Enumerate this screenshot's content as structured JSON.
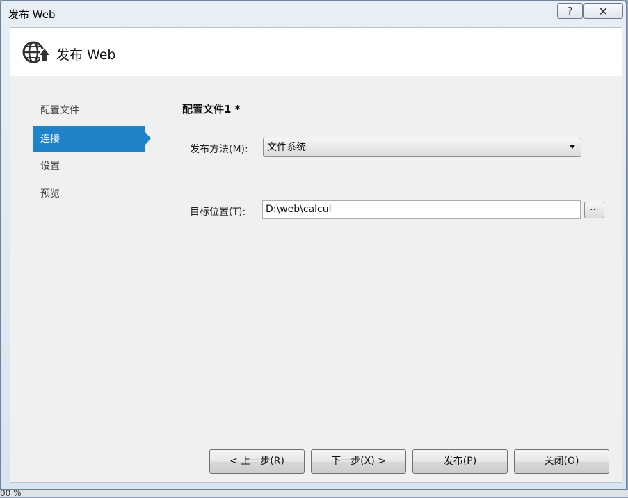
{
  "window": {
    "title": "发布 Web",
    "help_glyph": "?",
    "close_glyph": "✕"
  },
  "header": {
    "title": "发布 Web",
    "icon": "globe-publish-icon"
  },
  "nav": {
    "items": [
      {
        "label": "配置文件",
        "active": false
      },
      {
        "label": "连接",
        "active": true
      },
      {
        "label": "设置",
        "active": false
      },
      {
        "label": "预览",
        "active": false
      }
    ]
  },
  "main": {
    "profile_title": "配置文件1 *",
    "publish_method": {
      "label": "发布方法(M):",
      "value": "文件系统"
    },
    "target_location": {
      "label": "目标位置(T):",
      "value": "D:\\web\\calcul",
      "browse_label": "..."
    }
  },
  "footer": {
    "prev_label": "< 上一步(R)",
    "next_label": "下一步(X) >",
    "publish_label": "发布(P)",
    "close_label": "关闭(O)"
  },
  "status": {
    "zoom_text": "00 %"
  },
  "colors": {
    "accent": "#1e83c9",
    "content_bg": "#f0f0f0",
    "header_bg": "#ffffff"
  }
}
